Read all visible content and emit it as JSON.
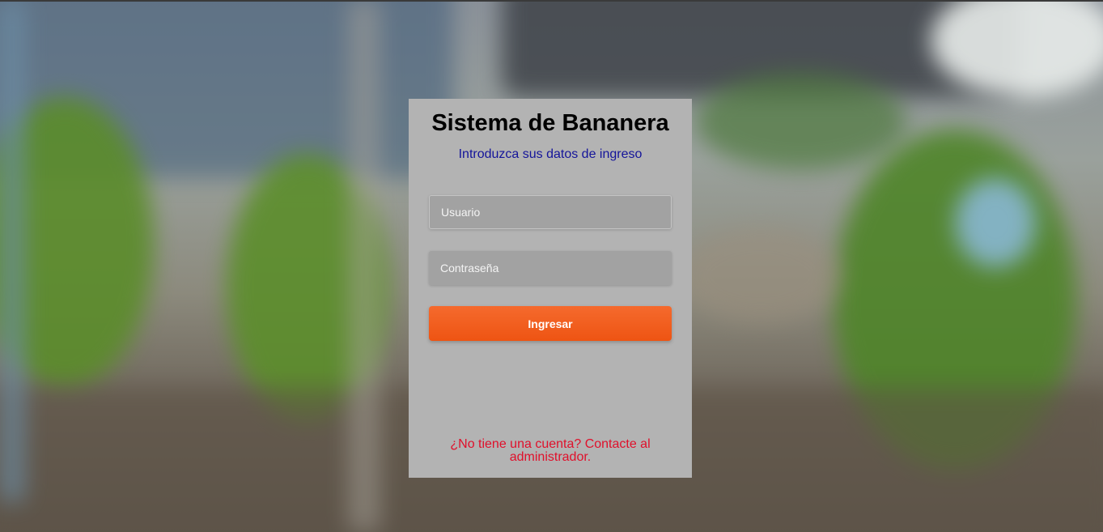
{
  "login": {
    "title": "Sistema de Bananera",
    "subtitle": "Introduzca sus datos de ingreso",
    "username": {
      "placeholder": "Usuario",
      "value": ""
    },
    "password": {
      "placeholder": "Contraseña",
      "value": ""
    },
    "submit_label": "Ingresar",
    "footer_line1": "¿No tiene una cuenta? Contacte al",
    "footer_line2": "administrador."
  },
  "colors": {
    "card_bg": "#b3b3b3",
    "title": "#000000",
    "subtitle": "#14149a",
    "button": "#f05a1c",
    "footer_link": "#e0102b"
  },
  "background": {
    "image": "banana-plantation-photo-blurred"
  }
}
